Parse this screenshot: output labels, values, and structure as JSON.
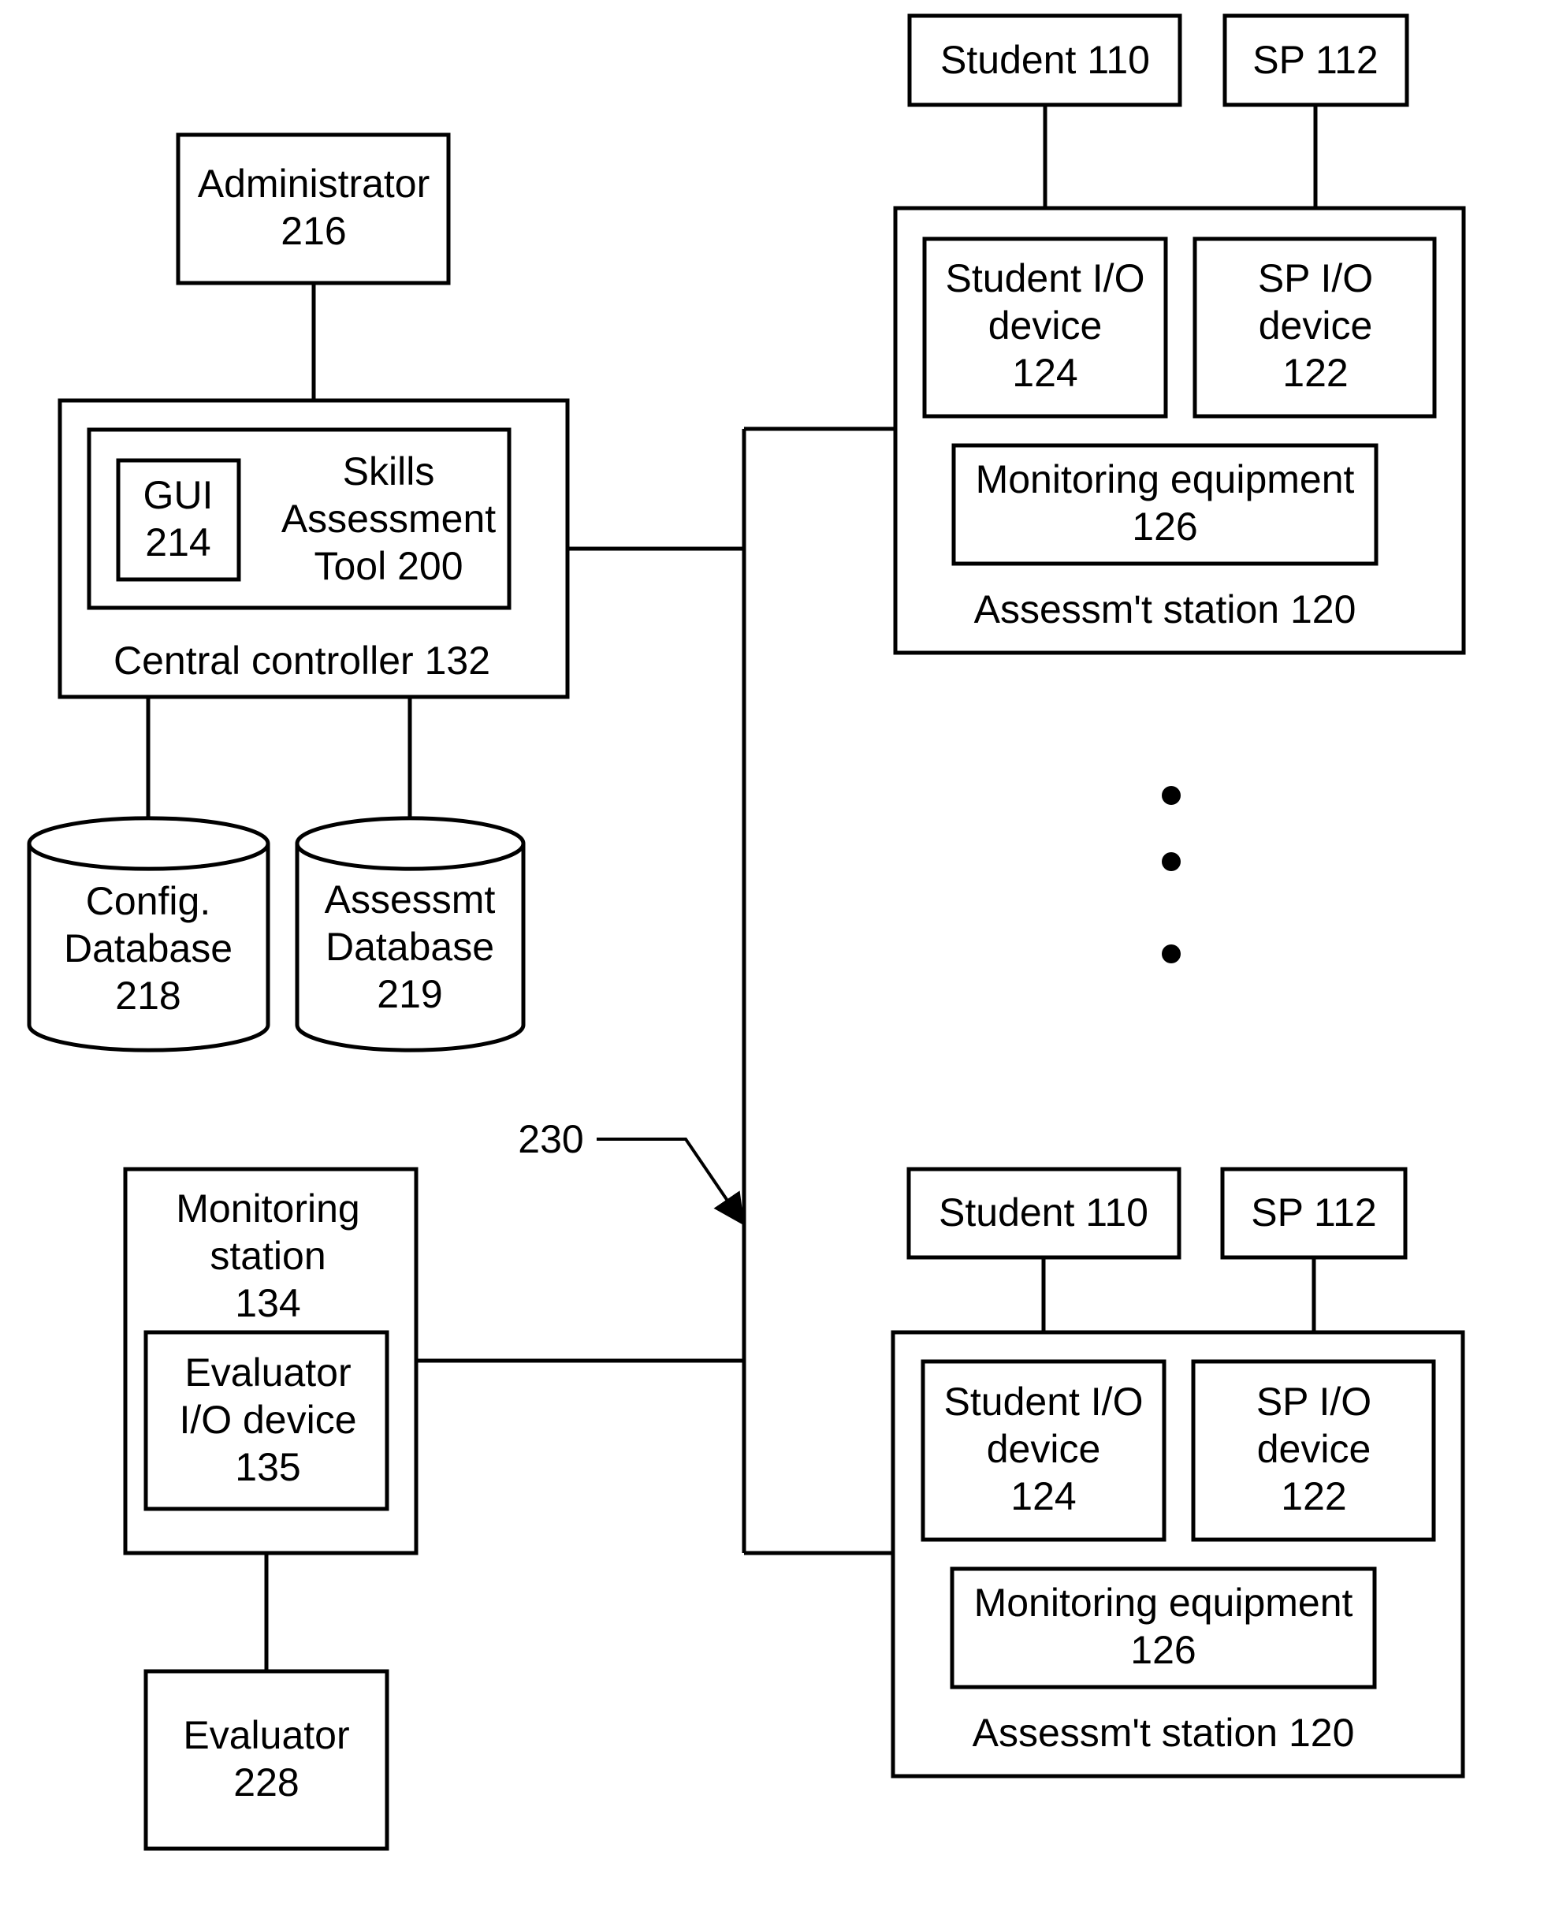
{
  "figure": {
    "administrator": {
      "lines": [
        "Administrator",
        "216"
      ]
    },
    "central_controller": {
      "label": "Central controller 132",
      "skills_tool": {
        "lines": [
          "Skills",
          "Assessment",
          "Tool 200"
        ]
      },
      "gui": {
        "lines": [
          "GUI",
          "214"
        ]
      }
    },
    "config_db": {
      "lines": [
        "Config.",
        "Database",
        "218"
      ]
    },
    "assess_db": {
      "lines": [
        "Assessmt",
        "Database",
        "219"
      ]
    },
    "network_label": "230",
    "monitoring_station": {
      "lines": [
        "Monitoring",
        "station",
        "134"
      ],
      "evaluator_io": {
        "lines": [
          "Evaluator",
          "I/O device",
          "135"
        ]
      }
    },
    "evaluator": {
      "lines": [
        "Evaluator",
        "228"
      ]
    },
    "stations": [
      {
        "student": "Student 110",
        "sp": "SP 112",
        "student_io": {
          "lines": [
            "Student I/O",
            "device",
            "124"
          ]
        },
        "sp_io": {
          "lines": [
            "SP I/O",
            "device",
            "122"
          ]
        },
        "monitoring_eq": {
          "lines": [
            "Monitoring equipment",
            "126"
          ]
        },
        "label": "Assessm't station 120"
      },
      {
        "student": "Student 110",
        "sp": "SP 112",
        "student_io": {
          "lines": [
            "Student I/O",
            "device",
            "124"
          ]
        },
        "sp_io": {
          "lines": [
            "SP I/O",
            "device",
            "122"
          ]
        },
        "monitoring_eq": {
          "lines": [
            "Monitoring equipment",
            "126"
          ]
        },
        "label": "Assessm't station 120"
      }
    ],
    "ellipsis_dots": 3
  }
}
